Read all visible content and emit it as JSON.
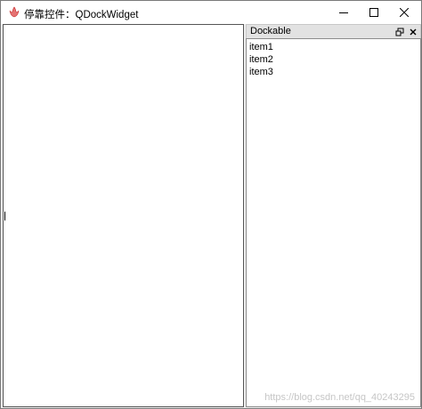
{
  "window": {
    "title": "停靠控件：QDockWidget",
    "app_icon": "qt-app-icon"
  },
  "titlebar_buttons": {
    "minimize_icon": "minimize-icon",
    "maximize_icon": "maximize-icon",
    "close_icon": "close-icon"
  },
  "dock": {
    "title": "Dockable",
    "float_icon": "float-icon",
    "close_icon": "close-icon",
    "items": [
      "item1",
      "item2",
      "item3"
    ]
  },
  "watermark": {
    "text": "https://blog.csdn.net/qq_40243295"
  }
}
